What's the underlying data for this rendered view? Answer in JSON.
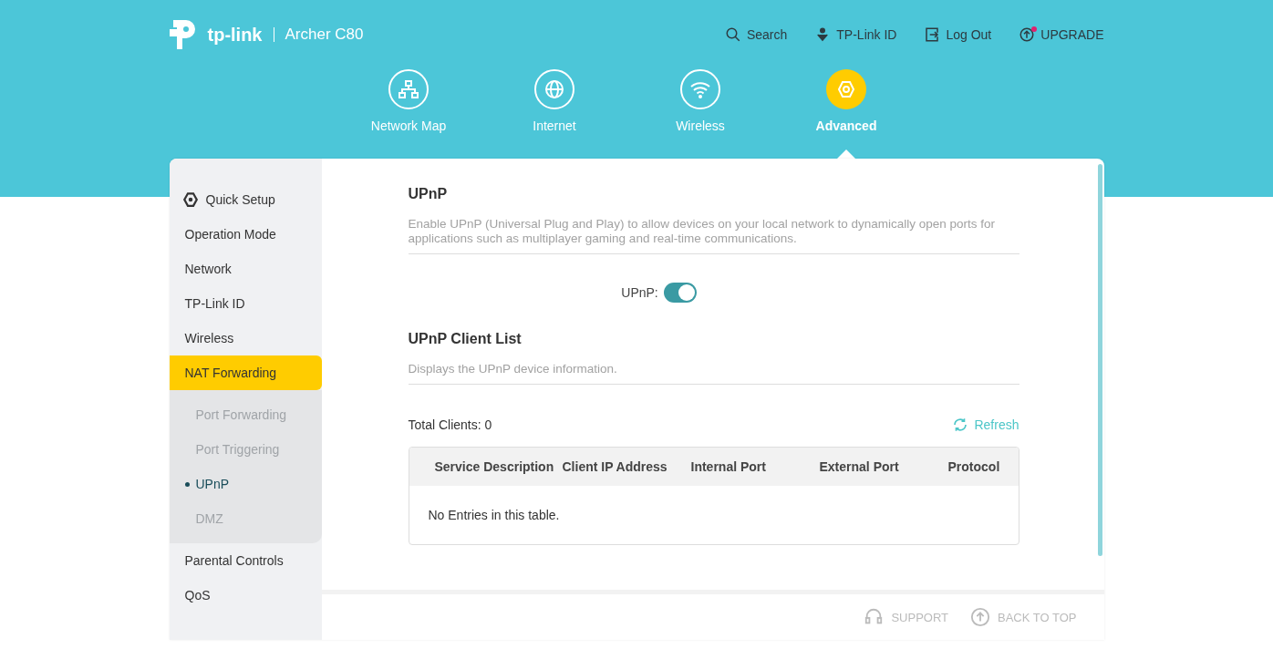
{
  "brand": {
    "logo": "tp-link",
    "model": "Archer C80"
  },
  "top_links": [
    {
      "label": "Search",
      "kind": "search"
    },
    {
      "label": "TP-Link ID",
      "kind": "id"
    },
    {
      "label": "Log Out",
      "kind": "logout"
    },
    {
      "label": "UPGRADE",
      "kind": "upgrade",
      "badge": true
    }
  ],
  "main_tabs": [
    {
      "label": "Network Map",
      "kind": "map",
      "selected": false
    },
    {
      "label": "Internet",
      "kind": "globe",
      "selected": false
    },
    {
      "label": "Wireless",
      "kind": "wifi",
      "selected": false
    },
    {
      "label": "Advanced",
      "kind": "gear",
      "selected": true
    }
  ],
  "sidebar": {
    "items": [
      {
        "label": "Quick Setup",
        "icon": true,
        "selected": false
      },
      {
        "label": "Operation Mode",
        "selected": false
      },
      {
        "label": "Network",
        "selected": false
      },
      {
        "label": "TP-Link ID",
        "selected": false
      },
      {
        "label": "Wireless",
        "selected": false
      },
      {
        "label": "NAT Forwarding",
        "selected": true,
        "expanded": true,
        "children": [
          {
            "label": "Port Forwarding",
            "selected": false
          },
          {
            "label": "Port Triggering",
            "selected": false
          },
          {
            "label": "UPnP",
            "selected": true
          },
          {
            "label": "DMZ",
            "selected": false
          }
        ]
      },
      {
        "label": "Parental Controls",
        "selected": false
      },
      {
        "label": "QoS",
        "selected": false
      }
    ]
  },
  "upnp": {
    "title": "UPnP",
    "description": "Enable UPnP (Universal Plug and Play) to allow devices on your local network to dynamically open ports for applications such as multiplayer gaming and real-time communications.",
    "toggle_label": "UPnP:",
    "on": true
  },
  "client_list": {
    "title": "UPnP Client List",
    "description": "Displays the UPnP device information.",
    "total": "Total Clients: 0",
    "refresh": "Refresh",
    "table": {
      "columns": [
        "Service Description",
        "Client IP Address",
        "Internal Port",
        "External Port",
        "Protocol"
      ],
      "empty": "No Entries in this table."
    }
  },
  "footer": {
    "links": [
      {
        "label": "SUPPORT",
        "kind": "support"
      },
      {
        "label": "BACK TO TOP",
        "kind": "top"
      }
    ]
  }
}
